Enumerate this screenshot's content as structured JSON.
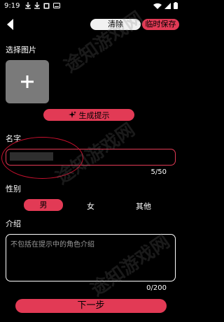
{
  "status_bar": {
    "time": "9:19"
  },
  "header": {
    "clear_label": "清除",
    "save_label": "临时保存"
  },
  "image_section": {
    "label": "选择图片"
  },
  "generate_button": {
    "label": "生成提示"
  },
  "name_section": {
    "label": "名字",
    "count": "5/50"
  },
  "gender_section": {
    "label": "性别",
    "options": [
      "男",
      "女",
      "其他"
    ],
    "selected": "男"
  },
  "intro_section": {
    "label": "介绍",
    "placeholder": "不包括在提示中的角色介绍",
    "count": "0/200"
  },
  "next_button": {
    "label": "下一步"
  },
  "watermark": {
    "text": "途知游戏网"
  },
  "colors": {
    "accent": "#e23a55",
    "annotation_red": "#c8102e",
    "background": "#000000"
  }
}
